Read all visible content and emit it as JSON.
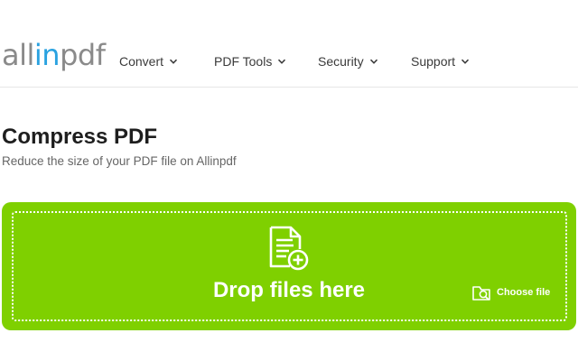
{
  "logo": {
    "part1": "all",
    "part2": "in",
    "part3": "pdf"
  },
  "nav": {
    "convert": "Convert",
    "pdf_tools": "PDF Tools",
    "security": "Security",
    "support": "Support"
  },
  "page": {
    "title": "Compress PDF",
    "subtitle": "Reduce the size of your PDF file on Allinpdf"
  },
  "dropzone": {
    "label": "Drop files here",
    "choose_file": "Choose file",
    "icon": "file-add-icon",
    "choose_icon": "folder-search-icon"
  },
  "colors": {
    "accent_green": "#7fd000",
    "logo_gray": "#8a8a8a",
    "logo_blue": "#2aa2e0"
  }
}
